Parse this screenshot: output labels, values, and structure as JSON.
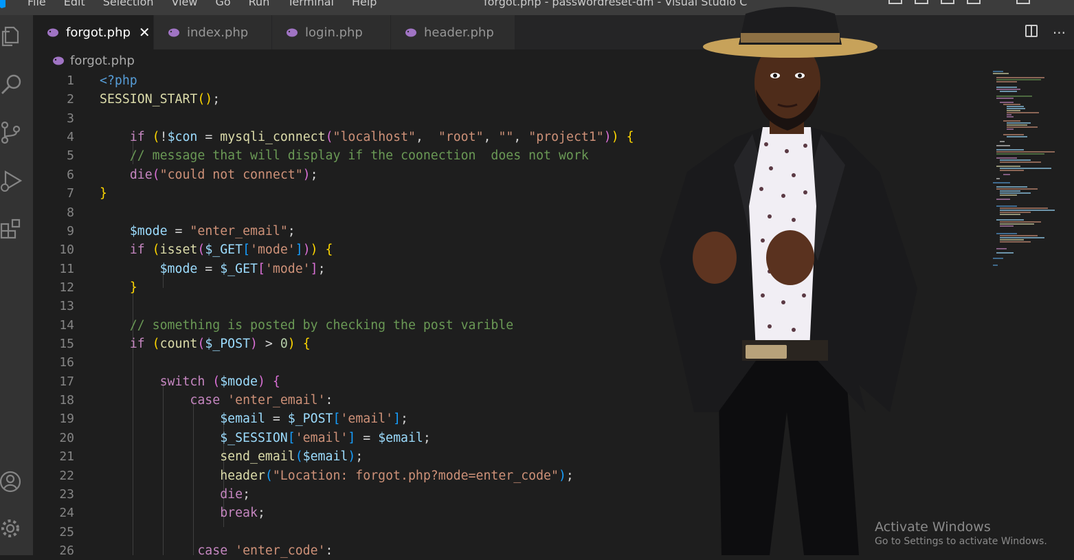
{
  "menubar": {
    "items": [
      "File",
      "Edit",
      "Selection",
      "View",
      "Go",
      "Run",
      "Terminal",
      "Help"
    ],
    "window_title": "forgot.php - passwordreset-dm - Visual Studio C"
  },
  "tabs": [
    {
      "label": "forgot.php",
      "active": true
    },
    {
      "label": "index.php",
      "active": false
    },
    {
      "label": "login.php",
      "active": false
    },
    {
      "label": "header.php",
      "active": false
    }
  ],
  "breadcrumb": {
    "file": "forgot.php"
  },
  "editor_actions": {
    "more": "···"
  },
  "code": {
    "line_numbers": [
      "1",
      "2",
      "3",
      "4",
      "5",
      "6",
      "7",
      "8",
      "9",
      "10",
      "11",
      "12",
      "13",
      "14",
      "15",
      "16",
      "17",
      "18",
      "19",
      "20",
      "21",
      "22",
      "23",
      "24",
      "25",
      "26"
    ]
  },
  "watermark": {
    "title": "Activate Windows",
    "subtitle": "Go to Settings to activate Windows."
  },
  "colors": {
    "editor_bg": "#1e1e1e",
    "activity_bar": "#333333",
    "keyword": "#c586c0",
    "function": "#dcdcaa",
    "variable": "#9cdcfe",
    "string": "#ce9178",
    "comment": "#6a9955"
  },
  "icons": [
    "explorer-icon",
    "search-icon",
    "source-control-icon",
    "run-debug-icon",
    "extensions-icon",
    "account-icon",
    "settings-gear-icon",
    "php-elephant-icon",
    "close-icon",
    "split-editor-icon"
  ]
}
